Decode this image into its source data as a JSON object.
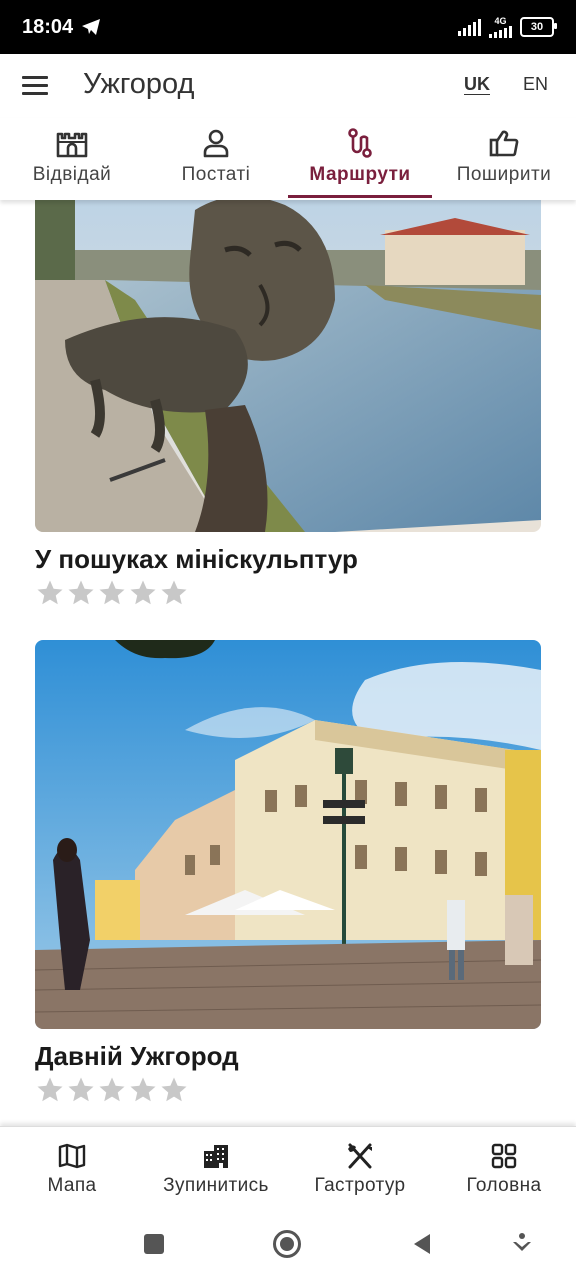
{
  "status_bar": {
    "time": "18:04",
    "network": "4G",
    "battery": "30"
  },
  "app_bar": {
    "title": "Ужгород",
    "lang_uk": "UK",
    "lang_en": "EN"
  },
  "tabs": [
    {
      "label": "Відвідай",
      "icon": "castle-icon"
    },
    {
      "label": "Постаті",
      "icon": "person-icon"
    },
    {
      "label": "Маршрути",
      "icon": "route-icon",
      "active": true
    },
    {
      "label": "Поширити",
      "icon": "thumbs-up-icon"
    }
  ],
  "routes": [
    {
      "title": "У пошуках мініскульптур",
      "rating": 0,
      "max_rating": 5
    },
    {
      "title": "Давній Ужгород",
      "rating": 0,
      "max_rating": 5
    }
  ],
  "bottom_nav": [
    {
      "label": "Мапа",
      "icon": "map-icon"
    },
    {
      "label": "Зупинитись",
      "icon": "building-icon"
    },
    {
      "label": "Гастротур",
      "icon": "cutlery-icon"
    },
    {
      "label": "Головна",
      "icon": "grid-icon"
    }
  ],
  "colors": {
    "accent": "#7a1f3d",
    "star_empty": "#c8c8c8"
  }
}
